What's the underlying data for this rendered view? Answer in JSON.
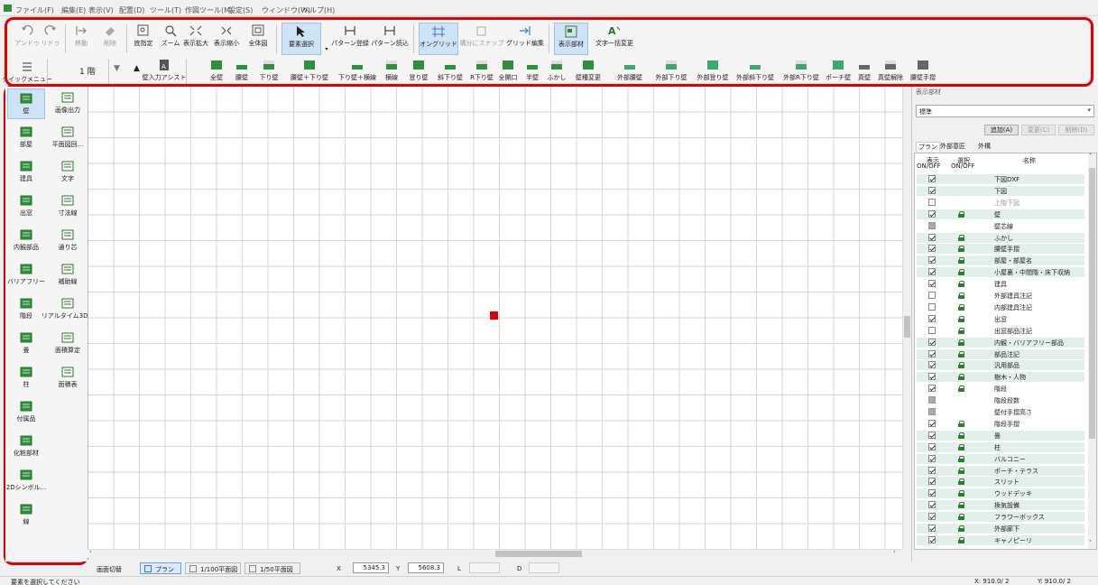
{
  "menu": [
    "ファイル(F)",
    "編集(E)",
    "表示(V)",
    "配置(D)",
    "ツール(T)",
    "作図ツール(M)",
    "設定(S)",
    "ウィンドウ(W)",
    "ヘルプ(H)"
  ],
  "toolbar1": {
    "undo": "アンドゥ",
    "redo": "リドゥ",
    "move": "移動",
    "delete": "削除",
    "base_point": "底指定",
    "zoom": "ズーム",
    "zoom_in": "表示拡大",
    "zoom_out": "表示縮小",
    "full_view": "全体図",
    "select_element": "要素選択",
    "pattern_register": "パターン登録",
    "pattern_load": "パターン読込",
    "on_grid": "オングリッド",
    "snap": "構分にスナップ",
    "grid_edit": "グリッド編集",
    "display_parts": "表示部材",
    "text_batch_change": "文字一括変更"
  },
  "toolbar2": {
    "quick_menu": "クイックメニュー",
    "floor": "1 階",
    "wall_input_assist": "壁入力アシスト",
    "walls": [
      "全壁",
      "腰壁",
      "下り壁",
      "腰壁＋下り壁",
      "下り壁＋横線",
      "横線",
      "登り壁",
      "斜下り壁",
      "R下り壁",
      "全開口",
      "半壁",
      "ふかし",
      "壁種変更",
      "外部腰壁",
      "外部下り壁",
      "外部登り壁",
      "外部斜下り壁",
      "外部R下り壁",
      "ポーチ壁",
      "真壁",
      "真壁解除",
      "腰壁手摺"
    ]
  },
  "sidebar": [
    {
      "label": "壁",
      "icon": "wall-icon",
      "selected": true
    },
    {
      "label": "画像出力",
      "icon": "image-output-icon"
    },
    {
      "label": "部屋",
      "icon": "room-icon"
    },
    {
      "label": "平面図回...",
      "icon": "floor-plan-icon"
    },
    {
      "label": "建具",
      "icon": "fitting-icon"
    },
    {
      "label": "文字",
      "icon": "text-icon"
    },
    {
      "label": "出窓",
      "icon": "bay-window-icon"
    },
    {
      "label": "寸法線",
      "icon": "dimension-icon"
    },
    {
      "label": "内観部品",
      "icon": "interior-parts-icon"
    },
    {
      "label": "通り芯",
      "icon": "grid-axis-icon"
    },
    {
      "label": "バリアフリー",
      "icon": "barrier-free-icon"
    },
    {
      "label": "補助線",
      "icon": "aux-line-icon"
    },
    {
      "label": "階段",
      "icon": "stairs-icon"
    },
    {
      "label": "リアルタイム3D...",
      "icon": "realtime-3d-icon"
    },
    {
      "label": "畳",
      "icon": "tatami-icon"
    },
    {
      "label": "面積算定",
      "icon": "area-calc-icon"
    },
    {
      "label": "柱",
      "icon": "column-icon"
    },
    {
      "label": "面積表",
      "icon": "area-table-icon"
    },
    {
      "label": "付属品",
      "icon": "accessory-icon"
    },
    {
      "label": "",
      "icon": ""
    },
    {
      "label": "化粧部材",
      "icon": "decorative-parts-icon"
    },
    {
      "label": "",
      "icon": ""
    },
    {
      "label": "2Dシンボル...",
      "icon": "2d-symbol-icon"
    },
    {
      "label": "",
      "icon": ""
    },
    {
      "label": "線",
      "icon": "line-icon"
    }
  ],
  "panel": {
    "title": "表示部材",
    "dropdown": "標準",
    "add": "追加(A)",
    "change": "変更(C)",
    "delete": "削除(D)",
    "tabs": [
      "プラン",
      "外部意匠",
      "外構"
    ],
    "col_show": "表示",
    "col_show2": "ON/OFF",
    "col_select": "選択",
    "col_select2": "ON/OFF",
    "col_name": "名称",
    "rows": [
      {
        "name": "下図DXF",
        "show": true,
        "lock": false
      },
      {
        "name": "下図",
        "show": true,
        "lock": false
      },
      {
        "name": "上階下図",
        "show": false,
        "lock": false,
        "dim": true
      },
      {
        "name": "壁",
        "show": true,
        "lock": true
      },
      {
        "name": "壁芯線",
        "show": "gray",
        "lock": false
      },
      {
        "name": "ふかし",
        "show": true,
        "lock": true
      },
      {
        "name": "腰壁手摺",
        "show": true,
        "lock": true
      },
      {
        "name": "部屋・部屋名",
        "show": true,
        "lock": true
      },
      {
        "name": "小屋裏・中間階・床下収納",
        "show": true,
        "lock": true
      },
      {
        "name": "建具",
        "show": true,
        "lock": true
      },
      {
        "name": "外部建具注記",
        "show": false,
        "lock": true
      },
      {
        "name": "内部建具注記",
        "show": false,
        "lock": true
      },
      {
        "name": "出窓",
        "show": true,
        "lock": true
      },
      {
        "name": "出窓部品注記",
        "show": false,
        "lock": true
      },
      {
        "name": "内観・バリアフリー部品",
        "show": true,
        "lock": true
      },
      {
        "name": "部品注記",
        "show": true,
        "lock": true
      },
      {
        "name": "汎用部品",
        "show": true,
        "lock": true
      },
      {
        "name": "樹木・人物",
        "show": true,
        "lock": true
      },
      {
        "name": "階段",
        "show": true,
        "lock": true
      },
      {
        "name": "階段段数",
        "show": "gray",
        "lock": false
      },
      {
        "name": "壁付手摺高さ",
        "show": "gray",
        "lock": false
      },
      {
        "name": "階段手摺",
        "show": true,
        "lock": true
      },
      {
        "name": "畳",
        "show": true,
        "lock": true
      },
      {
        "name": "柱",
        "show": true,
        "lock": true
      },
      {
        "name": "バルコニー",
        "show": true,
        "lock": true
      },
      {
        "name": "ポーチ・テラス",
        "show": true,
        "lock": true
      },
      {
        "name": "スリット",
        "show": true,
        "lock": true
      },
      {
        "name": "ウッドデッキ",
        "show": true,
        "lock": true
      },
      {
        "name": "換気設備",
        "show": true,
        "lock": true
      },
      {
        "name": "フラワーボックス",
        "show": true,
        "lock": true
      },
      {
        "name": "外部廊下",
        "show": true,
        "lock": true
      },
      {
        "name": "キャノピーリ",
        "show": true,
        "lock": true
      }
    ]
  },
  "status": {
    "screen_switch": "画面切替",
    "tab_plan": "プラン",
    "tab_100": "1/100平面図",
    "tab_50": "1/50平面図",
    "x_label": "X",
    "x_value": "5345.3",
    "y_label": "Y",
    "y_value": "5608.3",
    "l_label": "L",
    "d_label": "D"
  },
  "bottom": {
    "message": "要素を選択してください",
    "x_coord": "X: 910.0/ 2",
    "y_coord": "Y: 910.0/ 2"
  },
  "colors": {
    "accent": "#e00000",
    "selected": "#cfe3f6",
    "green_icon": "#2f8f3f"
  }
}
